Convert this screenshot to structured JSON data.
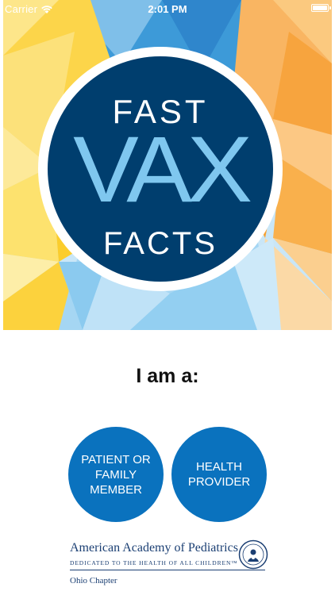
{
  "status_bar": {
    "carrier": "Carrier",
    "time": "2:01 PM"
  },
  "logo": {
    "line1": "FAST",
    "line2": "VAX",
    "line3": "FACTS"
  },
  "prompt": "I am a:",
  "choices": [
    {
      "label": "PATIENT OR FAMILY MEMBER"
    },
    {
      "label": "HEALTH PROVIDER"
    }
  ],
  "footer": {
    "org_name": "American Academy of Pediatrics",
    "tagline": "DEDICATED TO THE HEALTH OF ALL CHILDREN™",
    "chapter": "Ohio Chapter"
  },
  "colors": {
    "accent_blue": "#0a72be",
    "logo_navy": "#003e6e",
    "logo_light_blue": "#7fc7ef",
    "org_text": "#1b3f73"
  }
}
